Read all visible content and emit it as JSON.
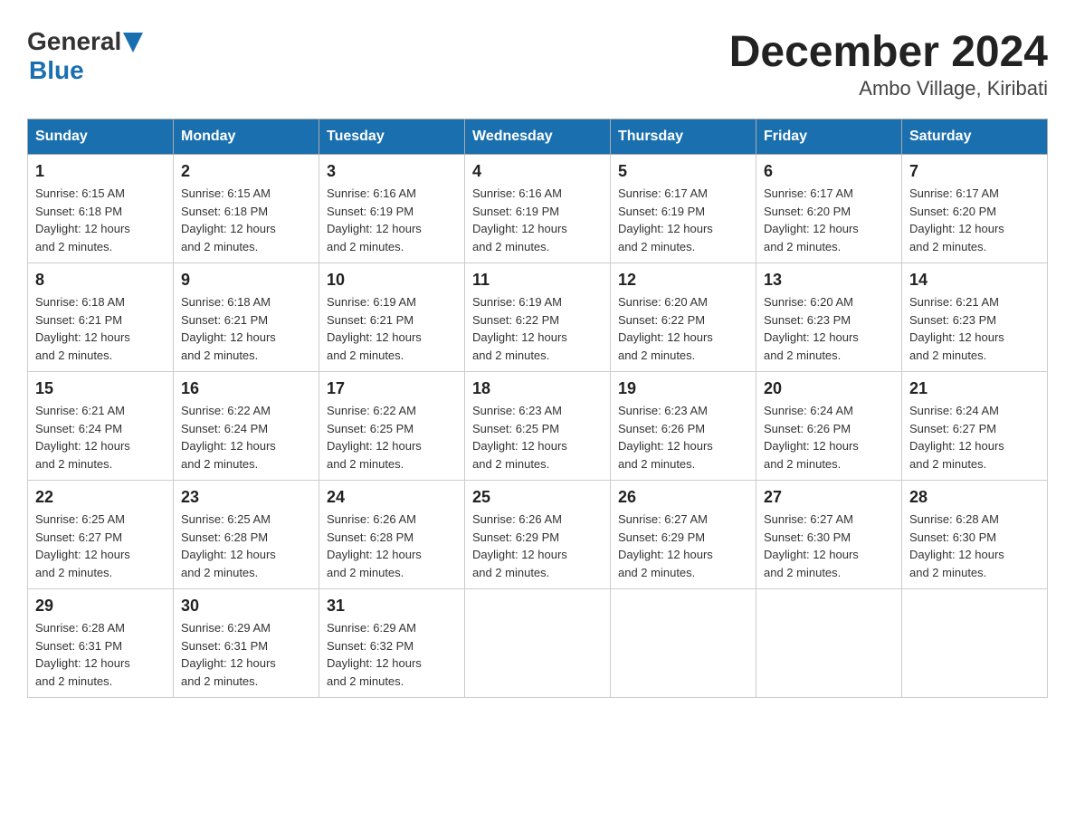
{
  "header": {
    "logo_general": "General",
    "logo_blue": "Blue",
    "title": "December 2024",
    "subtitle": "Ambo Village, Kiribati"
  },
  "days_of_week": [
    "Sunday",
    "Monday",
    "Tuesday",
    "Wednesday",
    "Thursday",
    "Friday",
    "Saturday"
  ],
  "weeks": [
    [
      {
        "day": "1",
        "sunrise": "6:15 AM",
        "sunset": "6:18 PM",
        "daylight": "12 hours and 2 minutes."
      },
      {
        "day": "2",
        "sunrise": "6:15 AM",
        "sunset": "6:18 PM",
        "daylight": "12 hours and 2 minutes."
      },
      {
        "day": "3",
        "sunrise": "6:16 AM",
        "sunset": "6:19 PM",
        "daylight": "12 hours and 2 minutes."
      },
      {
        "day": "4",
        "sunrise": "6:16 AM",
        "sunset": "6:19 PM",
        "daylight": "12 hours and 2 minutes."
      },
      {
        "day": "5",
        "sunrise": "6:17 AM",
        "sunset": "6:19 PM",
        "daylight": "12 hours and 2 minutes."
      },
      {
        "day": "6",
        "sunrise": "6:17 AM",
        "sunset": "6:20 PM",
        "daylight": "12 hours and 2 minutes."
      },
      {
        "day": "7",
        "sunrise": "6:17 AM",
        "sunset": "6:20 PM",
        "daylight": "12 hours and 2 minutes."
      }
    ],
    [
      {
        "day": "8",
        "sunrise": "6:18 AM",
        "sunset": "6:21 PM",
        "daylight": "12 hours and 2 minutes."
      },
      {
        "day": "9",
        "sunrise": "6:18 AM",
        "sunset": "6:21 PM",
        "daylight": "12 hours and 2 minutes."
      },
      {
        "day": "10",
        "sunrise": "6:19 AM",
        "sunset": "6:21 PM",
        "daylight": "12 hours and 2 minutes."
      },
      {
        "day": "11",
        "sunrise": "6:19 AM",
        "sunset": "6:22 PM",
        "daylight": "12 hours and 2 minutes."
      },
      {
        "day": "12",
        "sunrise": "6:20 AM",
        "sunset": "6:22 PM",
        "daylight": "12 hours and 2 minutes."
      },
      {
        "day": "13",
        "sunrise": "6:20 AM",
        "sunset": "6:23 PM",
        "daylight": "12 hours and 2 minutes."
      },
      {
        "day": "14",
        "sunrise": "6:21 AM",
        "sunset": "6:23 PM",
        "daylight": "12 hours and 2 minutes."
      }
    ],
    [
      {
        "day": "15",
        "sunrise": "6:21 AM",
        "sunset": "6:24 PM",
        "daylight": "12 hours and 2 minutes."
      },
      {
        "day": "16",
        "sunrise": "6:22 AM",
        "sunset": "6:24 PM",
        "daylight": "12 hours and 2 minutes."
      },
      {
        "day": "17",
        "sunrise": "6:22 AM",
        "sunset": "6:25 PM",
        "daylight": "12 hours and 2 minutes."
      },
      {
        "day": "18",
        "sunrise": "6:23 AM",
        "sunset": "6:25 PM",
        "daylight": "12 hours and 2 minutes."
      },
      {
        "day": "19",
        "sunrise": "6:23 AM",
        "sunset": "6:26 PM",
        "daylight": "12 hours and 2 minutes."
      },
      {
        "day": "20",
        "sunrise": "6:24 AM",
        "sunset": "6:26 PM",
        "daylight": "12 hours and 2 minutes."
      },
      {
        "day": "21",
        "sunrise": "6:24 AM",
        "sunset": "6:27 PM",
        "daylight": "12 hours and 2 minutes."
      }
    ],
    [
      {
        "day": "22",
        "sunrise": "6:25 AM",
        "sunset": "6:27 PM",
        "daylight": "12 hours and 2 minutes."
      },
      {
        "day": "23",
        "sunrise": "6:25 AM",
        "sunset": "6:28 PM",
        "daylight": "12 hours and 2 minutes."
      },
      {
        "day": "24",
        "sunrise": "6:26 AM",
        "sunset": "6:28 PM",
        "daylight": "12 hours and 2 minutes."
      },
      {
        "day": "25",
        "sunrise": "6:26 AM",
        "sunset": "6:29 PM",
        "daylight": "12 hours and 2 minutes."
      },
      {
        "day": "26",
        "sunrise": "6:27 AM",
        "sunset": "6:29 PM",
        "daylight": "12 hours and 2 minutes."
      },
      {
        "day": "27",
        "sunrise": "6:27 AM",
        "sunset": "6:30 PM",
        "daylight": "12 hours and 2 minutes."
      },
      {
        "day": "28",
        "sunrise": "6:28 AM",
        "sunset": "6:30 PM",
        "daylight": "12 hours and 2 minutes."
      }
    ],
    [
      {
        "day": "29",
        "sunrise": "6:28 AM",
        "sunset": "6:31 PM",
        "daylight": "12 hours and 2 minutes."
      },
      {
        "day": "30",
        "sunrise": "6:29 AM",
        "sunset": "6:31 PM",
        "daylight": "12 hours and 2 minutes."
      },
      {
        "day": "31",
        "sunrise": "6:29 AM",
        "sunset": "6:32 PM",
        "daylight": "12 hours and 2 minutes."
      },
      null,
      null,
      null,
      null
    ]
  ],
  "labels": {
    "sunrise": "Sunrise:",
    "sunset": "Sunset:",
    "daylight": "Daylight:"
  }
}
